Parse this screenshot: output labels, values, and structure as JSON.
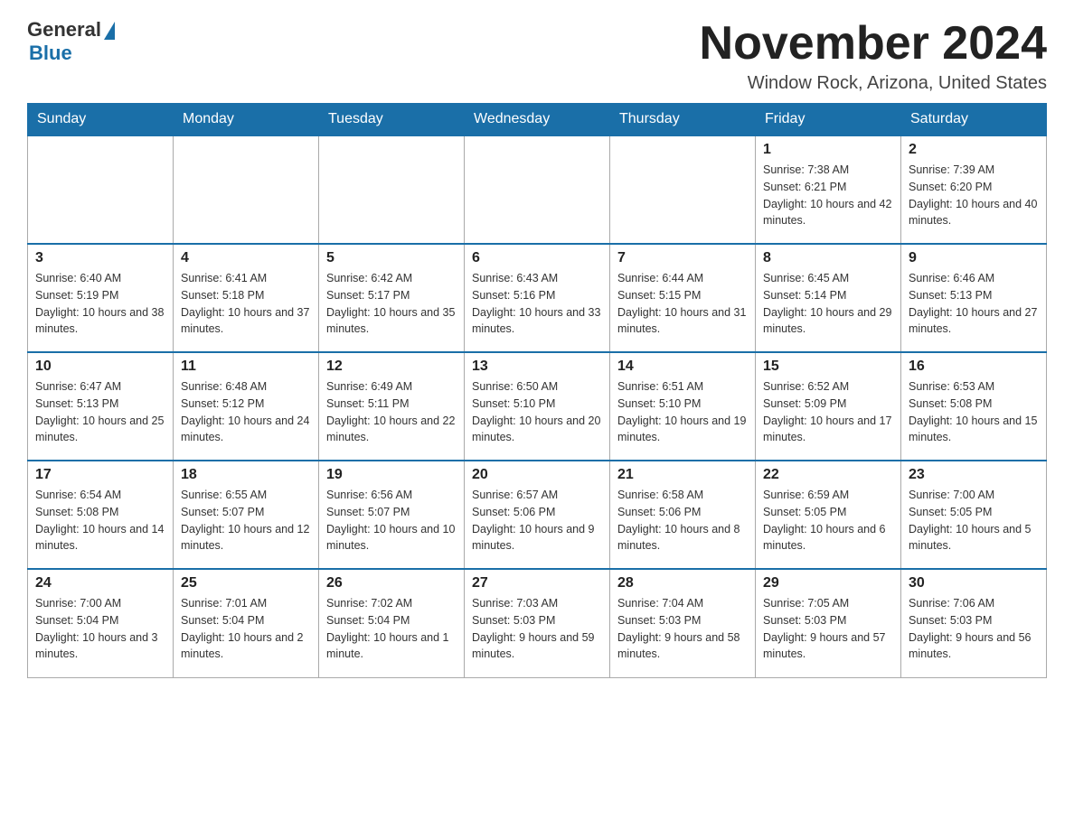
{
  "header": {
    "logo_general": "General",
    "logo_blue": "Blue",
    "month_title": "November 2024",
    "location": "Window Rock, Arizona, United States"
  },
  "days_of_week": [
    "Sunday",
    "Monday",
    "Tuesday",
    "Wednesday",
    "Thursday",
    "Friday",
    "Saturday"
  ],
  "weeks": [
    [
      {
        "day": "",
        "info": ""
      },
      {
        "day": "",
        "info": ""
      },
      {
        "day": "",
        "info": ""
      },
      {
        "day": "",
        "info": ""
      },
      {
        "day": "",
        "info": ""
      },
      {
        "day": "1",
        "info": "Sunrise: 7:38 AM\nSunset: 6:21 PM\nDaylight: 10 hours and 42 minutes."
      },
      {
        "day": "2",
        "info": "Sunrise: 7:39 AM\nSunset: 6:20 PM\nDaylight: 10 hours and 40 minutes."
      }
    ],
    [
      {
        "day": "3",
        "info": "Sunrise: 6:40 AM\nSunset: 5:19 PM\nDaylight: 10 hours and 38 minutes."
      },
      {
        "day": "4",
        "info": "Sunrise: 6:41 AM\nSunset: 5:18 PM\nDaylight: 10 hours and 37 minutes."
      },
      {
        "day": "5",
        "info": "Sunrise: 6:42 AM\nSunset: 5:17 PM\nDaylight: 10 hours and 35 minutes."
      },
      {
        "day": "6",
        "info": "Sunrise: 6:43 AM\nSunset: 5:16 PM\nDaylight: 10 hours and 33 minutes."
      },
      {
        "day": "7",
        "info": "Sunrise: 6:44 AM\nSunset: 5:15 PM\nDaylight: 10 hours and 31 minutes."
      },
      {
        "day": "8",
        "info": "Sunrise: 6:45 AM\nSunset: 5:14 PM\nDaylight: 10 hours and 29 minutes."
      },
      {
        "day": "9",
        "info": "Sunrise: 6:46 AM\nSunset: 5:13 PM\nDaylight: 10 hours and 27 minutes."
      }
    ],
    [
      {
        "day": "10",
        "info": "Sunrise: 6:47 AM\nSunset: 5:13 PM\nDaylight: 10 hours and 25 minutes."
      },
      {
        "day": "11",
        "info": "Sunrise: 6:48 AM\nSunset: 5:12 PM\nDaylight: 10 hours and 24 minutes."
      },
      {
        "day": "12",
        "info": "Sunrise: 6:49 AM\nSunset: 5:11 PM\nDaylight: 10 hours and 22 minutes."
      },
      {
        "day": "13",
        "info": "Sunrise: 6:50 AM\nSunset: 5:10 PM\nDaylight: 10 hours and 20 minutes."
      },
      {
        "day": "14",
        "info": "Sunrise: 6:51 AM\nSunset: 5:10 PM\nDaylight: 10 hours and 19 minutes."
      },
      {
        "day": "15",
        "info": "Sunrise: 6:52 AM\nSunset: 5:09 PM\nDaylight: 10 hours and 17 minutes."
      },
      {
        "day": "16",
        "info": "Sunrise: 6:53 AM\nSunset: 5:08 PM\nDaylight: 10 hours and 15 minutes."
      }
    ],
    [
      {
        "day": "17",
        "info": "Sunrise: 6:54 AM\nSunset: 5:08 PM\nDaylight: 10 hours and 14 minutes."
      },
      {
        "day": "18",
        "info": "Sunrise: 6:55 AM\nSunset: 5:07 PM\nDaylight: 10 hours and 12 minutes."
      },
      {
        "day": "19",
        "info": "Sunrise: 6:56 AM\nSunset: 5:07 PM\nDaylight: 10 hours and 10 minutes."
      },
      {
        "day": "20",
        "info": "Sunrise: 6:57 AM\nSunset: 5:06 PM\nDaylight: 10 hours and 9 minutes."
      },
      {
        "day": "21",
        "info": "Sunrise: 6:58 AM\nSunset: 5:06 PM\nDaylight: 10 hours and 8 minutes."
      },
      {
        "day": "22",
        "info": "Sunrise: 6:59 AM\nSunset: 5:05 PM\nDaylight: 10 hours and 6 minutes."
      },
      {
        "day": "23",
        "info": "Sunrise: 7:00 AM\nSunset: 5:05 PM\nDaylight: 10 hours and 5 minutes."
      }
    ],
    [
      {
        "day": "24",
        "info": "Sunrise: 7:00 AM\nSunset: 5:04 PM\nDaylight: 10 hours and 3 minutes."
      },
      {
        "day": "25",
        "info": "Sunrise: 7:01 AM\nSunset: 5:04 PM\nDaylight: 10 hours and 2 minutes."
      },
      {
        "day": "26",
        "info": "Sunrise: 7:02 AM\nSunset: 5:04 PM\nDaylight: 10 hours and 1 minute."
      },
      {
        "day": "27",
        "info": "Sunrise: 7:03 AM\nSunset: 5:03 PM\nDaylight: 9 hours and 59 minutes."
      },
      {
        "day": "28",
        "info": "Sunrise: 7:04 AM\nSunset: 5:03 PM\nDaylight: 9 hours and 58 minutes."
      },
      {
        "day": "29",
        "info": "Sunrise: 7:05 AM\nSunset: 5:03 PM\nDaylight: 9 hours and 57 minutes."
      },
      {
        "day": "30",
        "info": "Sunrise: 7:06 AM\nSunset: 5:03 PM\nDaylight: 9 hours and 56 minutes."
      }
    ]
  ]
}
